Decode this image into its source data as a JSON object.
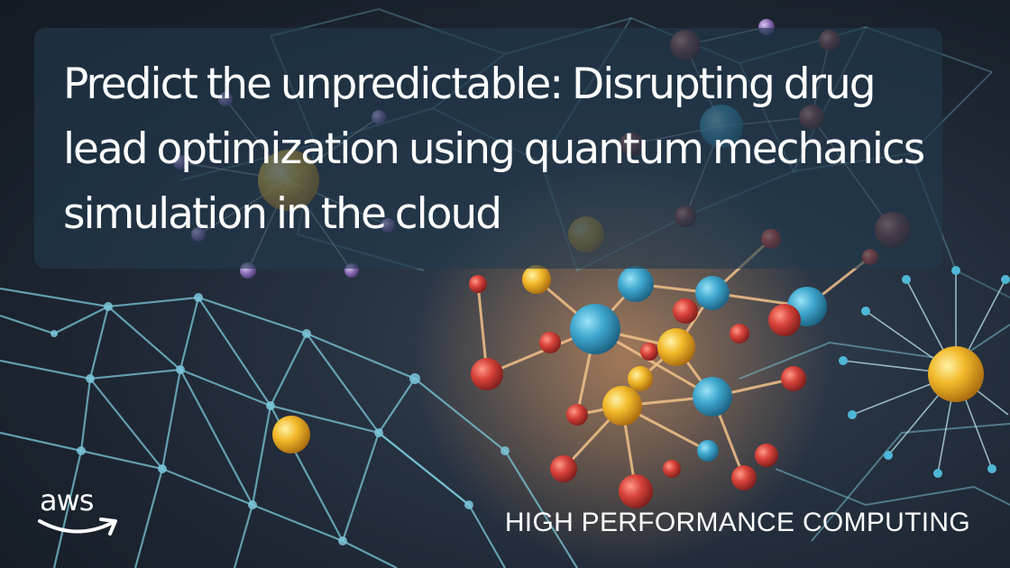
{
  "banner": {
    "title": "Predict the unpredictable: Disrupting drug lead optimization using quantum mechanics simulation in the cloud",
    "category": "HIGH PERFORMANCE COMPUTING",
    "logo_text": "aws"
  },
  "colors": {
    "background": "#1b2431",
    "title_panel": "#223a4e",
    "network_lines": "#6fb4c8",
    "atom_blue": "#3fa8cf",
    "atom_red": "#d8433a",
    "atom_yellow": "#f2b92a",
    "atom_purple": "#8d72b8",
    "text": "#ffffff"
  },
  "icons": [
    "molecule-network-illustration",
    "aws-logo",
    "aws-smile-arrow-icon"
  ]
}
